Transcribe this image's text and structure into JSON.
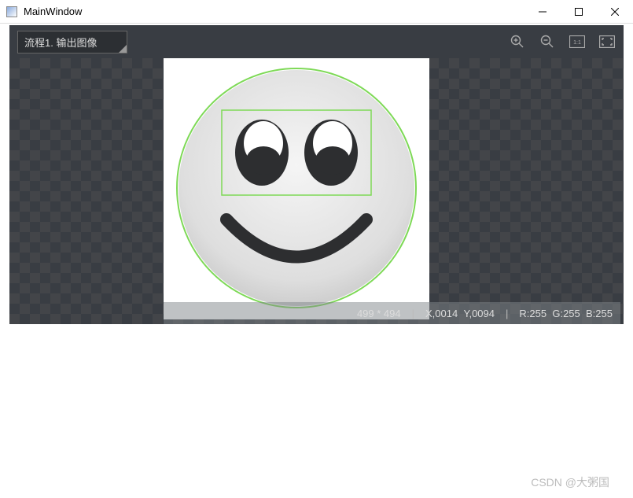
{
  "window": {
    "title": "MainWindow"
  },
  "toolbar": {
    "dropdown_label": "流程1. 输出图像"
  },
  "status": {
    "dimensions": "499 * 494",
    "coord_x_label": "X",
    "coord_x_value": "0014",
    "coord_y_label": "Y",
    "coord_y_value": "0094",
    "r_label": "R:",
    "r_value": "255",
    "g_label": "G:",
    "g_value": "255",
    "b_label": "B:",
    "b_value": "255"
  },
  "annotations": {
    "circle_color": "#7ed957",
    "rect_color": "#7ed957"
  },
  "watermark": "CSDN @大粥国"
}
